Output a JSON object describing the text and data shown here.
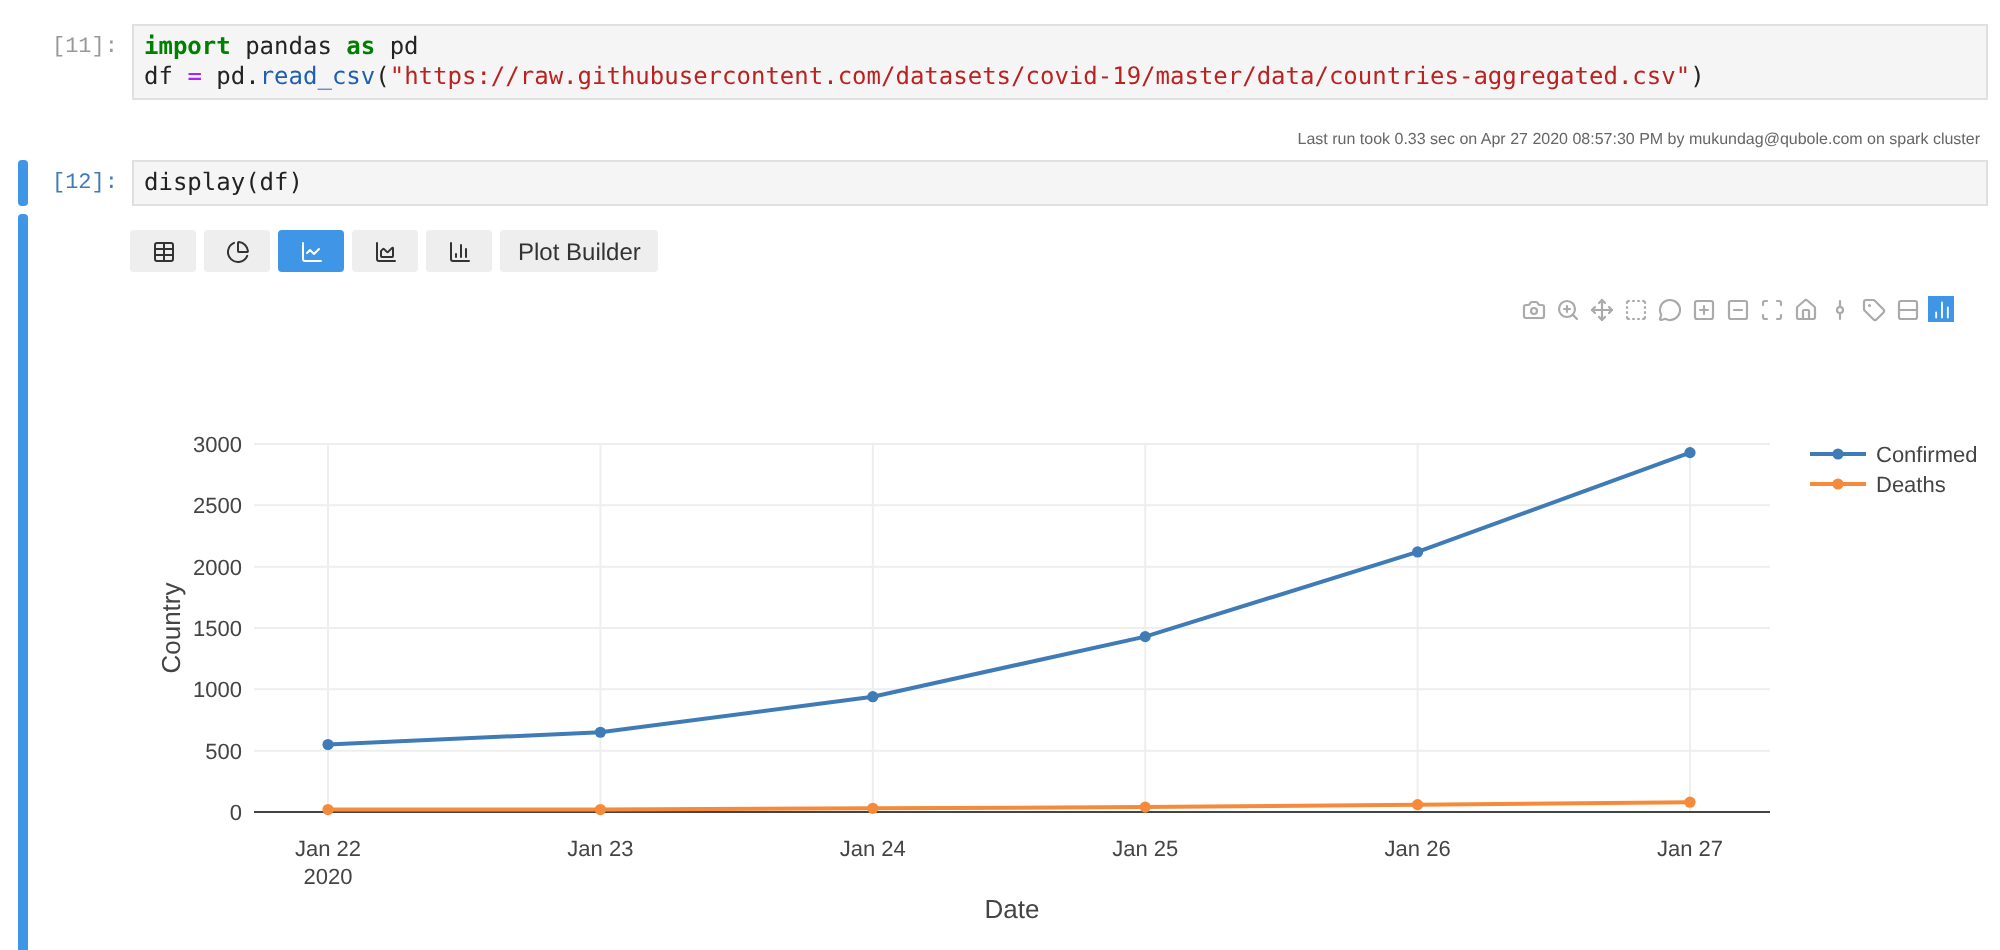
{
  "cells": [
    {
      "prompt": "[11]:",
      "active": false,
      "lines": [
        [
          {
            "text": "import",
            "kind": "keyword"
          },
          {
            "text": " pandas ",
            "kind": "plain"
          },
          {
            "text": "as",
            "kind": "keyword"
          },
          {
            "text": " pd",
            "kind": "plain"
          }
        ],
        [
          {
            "text": "df ",
            "kind": "plain"
          },
          {
            "text": "=",
            "kind": "operator"
          },
          {
            "text": " pd.",
            "kind": "plain"
          },
          {
            "text": "read_csv",
            "kind": "func"
          },
          {
            "text": "(",
            "kind": "plain"
          },
          {
            "text": "\"https://raw.githubusercontent.com/datasets/covid-19/master/data/countries-aggregated.csv\"",
            "kind": "string"
          },
          {
            "text": ")",
            "kind": "plain"
          }
        ]
      ],
      "run_info": "Last run took 0.33 sec on Apr 27 2020 08:57:30 PM by mukundag@qubole.com on spark cluster"
    },
    {
      "prompt": "[12]:",
      "active": true,
      "lines": [
        [
          {
            "text": "display(df)",
            "kind": "plain"
          }
        ]
      ]
    }
  ],
  "output": {
    "view_buttons": [
      {
        "kind": "table",
        "selected": false
      },
      {
        "kind": "pie",
        "selected": false
      },
      {
        "kind": "line",
        "selected": true
      },
      {
        "kind": "area",
        "selected": false
      },
      {
        "kind": "bar",
        "selected": false
      },
      {
        "kind": "text",
        "label": "Plot Builder",
        "selected": false
      }
    ],
    "chart_data": {
      "type": "line",
      "grid": true,
      "legend": true,
      "xlabel": "Date",
      "ylabel": "Country",
      "categories": [
        "Jan 22\n2020",
        "Jan 23",
        "Jan 24",
        "Jan 25",
        "Jan 26",
        "Jan 27"
      ],
      "series": [
        {
          "name": "Confirmed",
          "color": "#3f7bb6",
          "marker": true,
          "values": [
            550,
            650,
            940,
            1430,
            2120,
            2930
          ]
        },
        {
          "name": "Deaths",
          "color": "#f58a3a",
          "marker": true,
          "values": [
            20,
            20,
            30,
            40,
            60,
            80
          ]
        }
      ],
      "ylim": [
        0,
        3000
      ],
      "yticks": [
        0,
        500,
        1000,
        1500,
        2000,
        2500,
        3000
      ]
    }
  }
}
